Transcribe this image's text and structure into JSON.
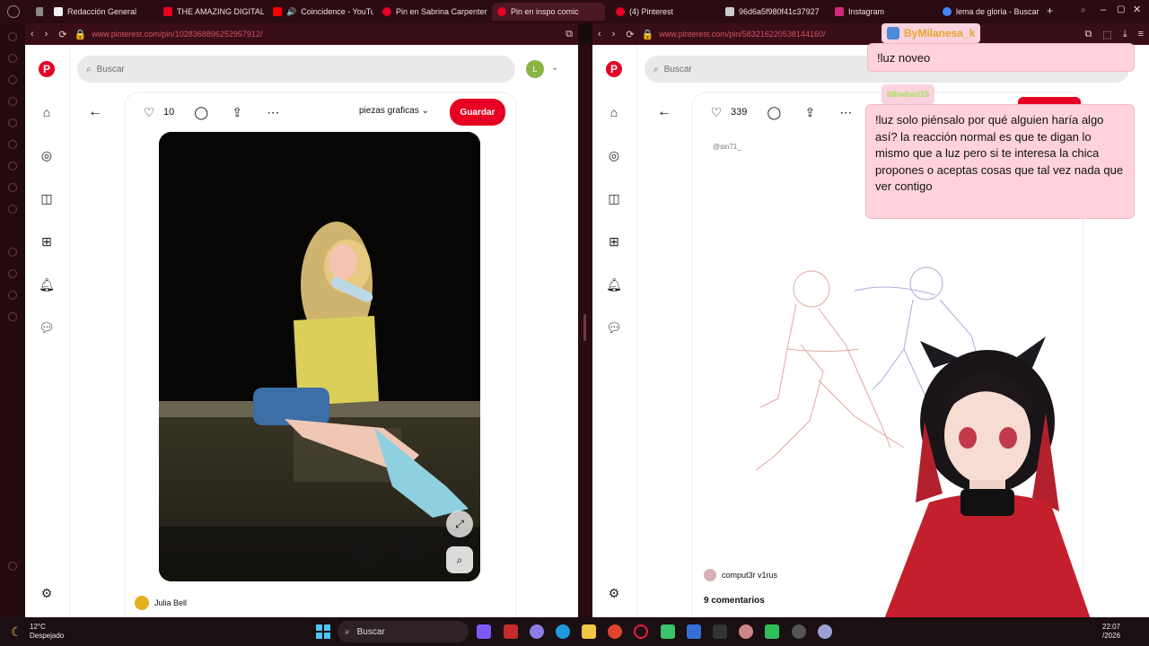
{
  "tabs": [
    {
      "label": "Redacción General",
      "color": "#f2f2f2"
    },
    {
      "label": "THE AMAZING DIGITAL",
      "color": "#e60023"
    },
    {
      "label": "Coincidence - YouTu",
      "color": "#ff0000"
    },
    {
      "label": "Pin en Sabrina Carpenter",
      "color": "#e60023"
    },
    {
      "label": "Pin en inspo comic",
      "color": "#e60023"
    },
    {
      "label": "(4) Pinterest",
      "color": "#e60023"
    },
    {
      "label": "96d6a5f980f41c37927",
      "color": "#cccccc"
    },
    {
      "label": "Instagram",
      "color": "#d6287a"
    },
    {
      "label": "lema de gloria - Buscar",
      "color": "#4285f4"
    }
  ],
  "new_tab_label": "+",
  "left_pane": {
    "url": "www.pinterest.com/pin/1028368896252957912/",
    "search_placeholder": "Buscar",
    "avatar_letter": "L",
    "like_count": "10",
    "board_name": "piezas graficas",
    "save_label": "Guardar",
    "author": "Julia Bell"
  },
  "right_pane": {
    "url": "www.pinterest.com/pin/583216220538144160/",
    "search_placeholder": "Buscar",
    "like_count": "339",
    "handle": "@sin71_",
    "author": "comput3r v1rus",
    "comments": "9 comentarios"
  },
  "chat": [
    {
      "name": "ByMilanesa_k",
      "message": "!luz noveo"
    },
    {
      "name": "ltlhwbari15",
      "message": "!luz solo piénsalo por qué alguien haría algo así? la reacción normal es que te digan lo mismo que a luz pero si te interesa la chica propones o aceptas cosas que tal vez nada que ver contigo"
    }
  ],
  "taskbar": {
    "temp": "12°C",
    "weather": "Despejado",
    "search_placeholder": "Buscar",
    "time": "22:07",
    "date": "/2026"
  },
  "colors": {
    "accent": "#e60023",
    "bubble": "#ffd2dc",
    "chrome": "#2a0b11"
  }
}
